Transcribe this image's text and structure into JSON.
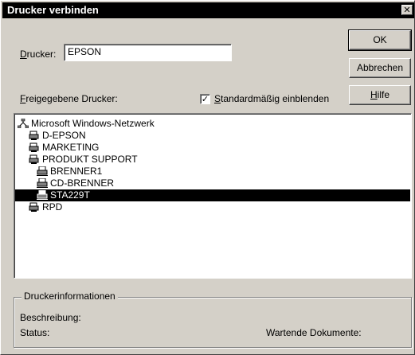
{
  "window": {
    "title": "Drucker verbinden",
    "close_glyph": "✕"
  },
  "printer_field": {
    "label_accel": "D",
    "label_rest": "rucker:",
    "value": "EPSON"
  },
  "buttons": {
    "ok": "OK",
    "cancel": "Abbrechen",
    "help_accel": "H",
    "help_rest": "ilfe"
  },
  "shared_label": {
    "accel": "F",
    "rest": "reigegebene Drucker:"
  },
  "show_default": {
    "checked": true,
    "check_glyph": "✓",
    "accel": "S",
    "rest": "tandardmäßig einblenden"
  },
  "tree": [
    {
      "label": "Microsoft Windows-Netzwerk",
      "icon": "network-icon",
      "level": 0,
      "selected": false
    },
    {
      "label": "D-EPSON",
      "icon": "printer-server-icon",
      "level": 1,
      "selected": false
    },
    {
      "label": "MARKETING",
      "icon": "printer-server-icon",
      "level": 1,
      "selected": false
    },
    {
      "label": "PRODUKT SUPPORT",
      "icon": "printer-server-icon",
      "level": 1,
      "selected": false
    },
    {
      "label": "BRENNER1",
      "icon": "printer-icon",
      "level": 2,
      "selected": false
    },
    {
      "label": "CD-BRENNER",
      "icon": "printer-icon",
      "level": 2,
      "selected": false
    },
    {
      "label": "STA229T",
      "icon": "printer-icon",
      "level": 2,
      "selected": true
    },
    {
      "label": "RPD",
      "icon": "printer-server-icon",
      "level": 1,
      "selected": false
    }
  ],
  "info": {
    "title": "Druckerinformationen",
    "description_label": "Beschreibung:",
    "status_label": "Status:",
    "waiting_label": "Wartende Dokumente:"
  }
}
